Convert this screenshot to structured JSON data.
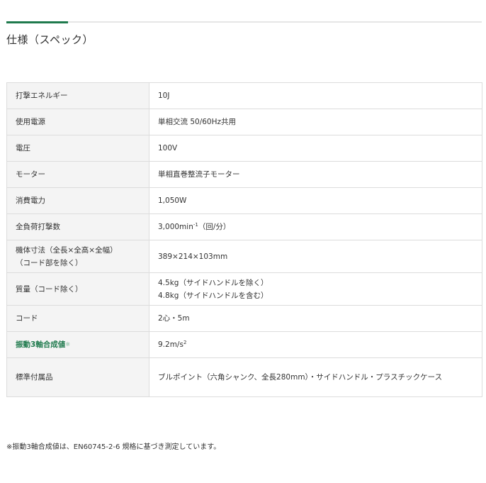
{
  "page": {
    "title": "仕様（スペック）"
  },
  "spec_rows": [
    {
      "label": "打撃エネルギー",
      "value": [
        "10J"
      ]
    },
    {
      "label": "使用電源",
      "value": [
        "単相交流 50/60Hz共用"
      ]
    },
    {
      "label": "電圧",
      "value": [
        "100V"
      ]
    },
    {
      "label": "モーター",
      "value": [
        "単相直巻整流子モーター"
      ]
    },
    {
      "label": "消費電力",
      "value": [
        "1,050W"
      ]
    },
    {
      "label": "全負荷打撃数",
      "value_prefix": "3,000min",
      "value_sup": "-1",
      "value_suffix": "（回/分）"
    },
    {
      "label_lines": [
        "機体寸法（全長×全高×全幅）",
        "（コード部を除く）"
      ],
      "value": [
        "389×214×103mm"
      ]
    },
    {
      "label": "質量（コード除く）",
      "value": [
        "4.5kg（サイドハンドルを除く）",
        "4.8kg（サイドハンドルを含む）"
      ]
    },
    {
      "label": "コード",
      "value": [
        "2心・5m"
      ]
    },
    {
      "label": "振動3軸合成値",
      "label_mark": "※",
      "value_prefix": "9.2m/s",
      "value_sup": "2"
    },
    {
      "label": "標準付属品",
      "value": [
        "ブルポイント（六角シャンク、全長280mm）・サイドハンドル・プラスチックケース"
      ]
    }
  ],
  "footnote": {
    "mark": "※",
    "emphasis": "振動3軸合成値",
    "text": "は、EN60745-2-6 規格に基づき測定しています。"
  },
  "colors": {
    "accent": "#1f7a4d",
    "label_bg": "#f4f4f4",
    "border": "#dcdcdc"
  }
}
